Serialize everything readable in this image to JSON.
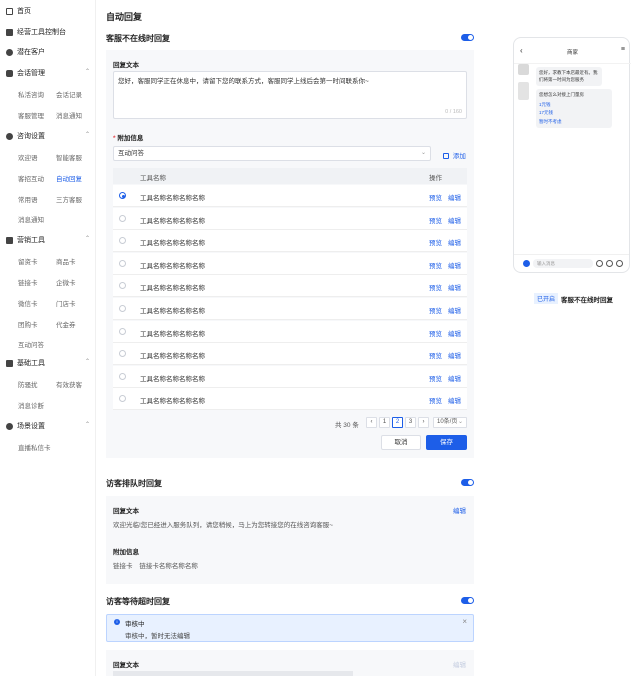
{
  "sidebar": {
    "home": "首页",
    "console": "经营工具控制台",
    "potential": "潜在客户",
    "groups": [
      {
        "label": "会话管理",
        "items": [
          "私活咨询",
          "会话记录",
          "客服管理",
          "消息通知"
        ]
      },
      {
        "label": "咨询设置",
        "items": [
          "欢迎语",
          "智能客服",
          "客招互动",
          "自动回复",
          "常用语",
          "三方客服",
          "消息通知"
        ]
      },
      {
        "label": "营销工具",
        "items": [
          "留资卡",
          "商品卡",
          "链接卡",
          "企微卡",
          "微信卡",
          "门店卡",
          "团购卡",
          "代金券",
          "互动问答"
        ]
      },
      {
        "label": "基础工具",
        "items": [
          "防骚扰",
          "有效获客",
          "消息诊断"
        ]
      },
      {
        "label": "场景设置",
        "items": [
          "直播私信卡"
        ]
      }
    ],
    "active_item": "自动回复"
  },
  "page": {
    "title": "自动回复"
  },
  "offline": {
    "title": "客服不在线时回复",
    "reply_label": "回复文本",
    "reply_text": "您好，客服同学正在休息中，请留下您的联系方式，客服同学上线后会第一时间联系你~",
    "counter": "0 / 160",
    "attach_label": "附加信息",
    "select_value": "互动问答",
    "add_label": "添加",
    "table": {
      "col_name": "工具名称",
      "col_ops": "操作",
      "rows": [
        "工具名称名称名称名称",
        "工具名称名称名称名称",
        "工具名称名称名称名称",
        "工具名称名称名称名称",
        "工具名称名称名称名称",
        "工具名称名称名称名称",
        "工具名称名称名称名称",
        "工具名称名称名称名称",
        "工具名称名称名称名称",
        "工具名称名称名称名称"
      ],
      "preview": "预览",
      "edit": "编辑"
    },
    "pagination": {
      "total": "共 30 条",
      "pages": [
        "1",
        "2",
        "3"
      ],
      "current": "2",
      "page_size": "10条/页"
    },
    "cancel": "取消",
    "save": "保存"
  },
  "queue": {
    "title": "访客排队时回复",
    "reply_label": "回复文本",
    "edit": "编辑",
    "reply_text": "欢迎光临!您已经进入服务队列，请您稍候，马上为您转接您的在线咨询客服~",
    "attach_label": "附加信息",
    "attach_type": "链接卡",
    "attach_value": "链接卡名称名称名称"
  },
  "timeout": {
    "title": "访客等待超时回复",
    "notice_title": "审核中",
    "notice_text": "审核中，暂时无法编辑",
    "reply_label": "回复文本",
    "edit": "编辑"
  },
  "preview": {
    "header": "商家",
    "bubble1": "您好，求教下本店最近有。我们将第一时间为您服务",
    "bubble2_title": "您想怎么对接上门量房",
    "bubble2_lines": [
      "1元钱",
      "17元钱",
      "暂时不考虑"
    ],
    "input_placeholder": "输入消息",
    "status_badge": "已开启",
    "status_label": "客服不在线时回复"
  },
  "colors": {
    "accent": "#1d5ee8"
  }
}
